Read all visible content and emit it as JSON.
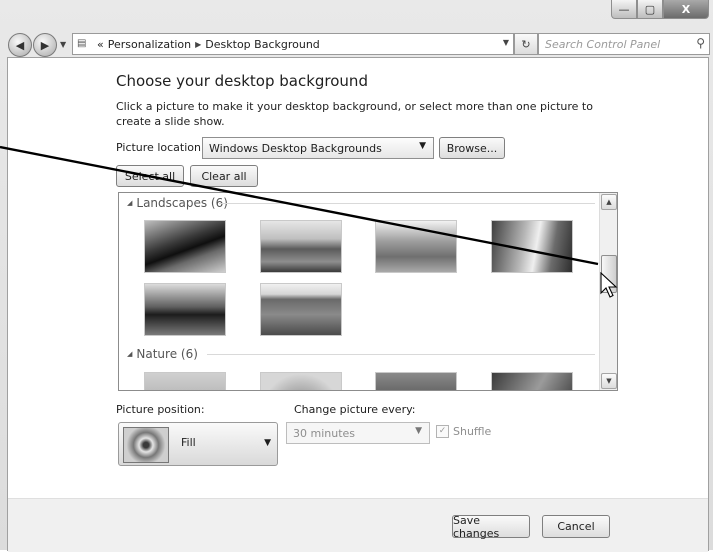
{
  "window": {
    "buttons": {
      "minimize": "—",
      "maximize": "▢",
      "close": "X"
    }
  },
  "nav": {
    "back_glyph": "◀",
    "forward_glyph": "▶",
    "dropdown_glyph": "▼",
    "breadcrumb": [
      "«",
      "Personalization",
      "Desktop Background"
    ],
    "crumb_separator": "▶",
    "refresh_glyph": "↻",
    "search_placeholder": "Search Control Panel",
    "search_glyph": "⚲"
  },
  "main": {
    "heading": "Choose your desktop background",
    "description": "Click a picture to make it your desktop background, or select more than one picture to create a slide show.",
    "picture_location_label": "Picture location:",
    "picture_location_value": "Windows Desktop Backgrounds",
    "browse_label": "Browse...",
    "select_all_label": "Select all",
    "clear_all_label": "Clear all"
  },
  "gallery": {
    "groups": [
      {
        "label": "Landscapes (6)",
        "count": 6
      },
      {
        "label": "Nature (6)",
        "count": 6
      }
    ],
    "collapse_glyph": "◢",
    "scroll_up_glyph": "▲",
    "scroll_down_glyph": "▼"
  },
  "options": {
    "picture_position_label": "Picture position:",
    "picture_position_value": "Fill",
    "change_picture_label": "Change picture every:",
    "interval_value": "30 minutes",
    "shuffle_label": "Shuffle",
    "shuffle_checked": true
  },
  "footer": {
    "save_label": "Save changes",
    "cancel_label": "Cancel"
  },
  "colors": {
    "window_chrome": "#dcdcdc",
    "content_bg": "#ffffff",
    "disabled_text": "#8e8e8e"
  }
}
